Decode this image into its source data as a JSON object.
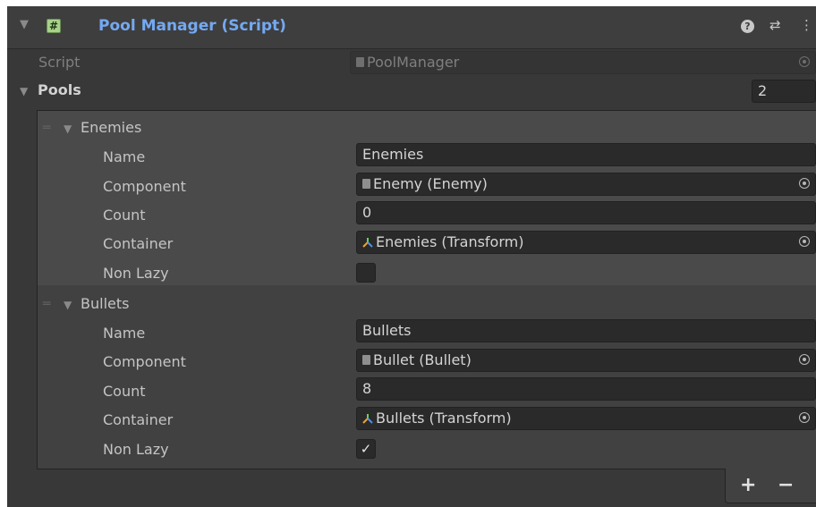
{
  "component": {
    "title": "Pool Manager (Script)",
    "enabled_glyph": "#",
    "icons": [
      "help-icon",
      "preset-icon",
      "context-menu-icon"
    ]
  },
  "script_field": {
    "label": "Script",
    "value": "PoolManager"
  },
  "pools": {
    "label": "Pools",
    "size": "2",
    "elements": [
      {
        "header": "Enemies",
        "name_label": "Name",
        "name_value": "Enemies",
        "component_label": "Component",
        "component_value": "Enemy (Enemy)",
        "count_label": "Count",
        "count_value": "0",
        "container_label": "Container",
        "container_value": "Enemies (Transform)",
        "nonlazy_label": "Non Lazy",
        "nonlazy_checked": false
      },
      {
        "header": "Bullets",
        "name_label": "Name",
        "name_value": "Bullets",
        "component_label": "Component",
        "component_value": "Bullet (Bullet)",
        "count_label": "Count",
        "count_value": "8",
        "container_label": "Container",
        "container_value": "Bullets (Transform)",
        "nonlazy_label": "Non Lazy",
        "nonlazy_checked": true
      }
    ]
  },
  "footer": {
    "add": "+",
    "remove": "−"
  },
  "colors": {
    "title": "#74a9f2",
    "panel": "#383838",
    "field": "#2a2a2a",
    "enable": "#a8d28a"
  }
}
